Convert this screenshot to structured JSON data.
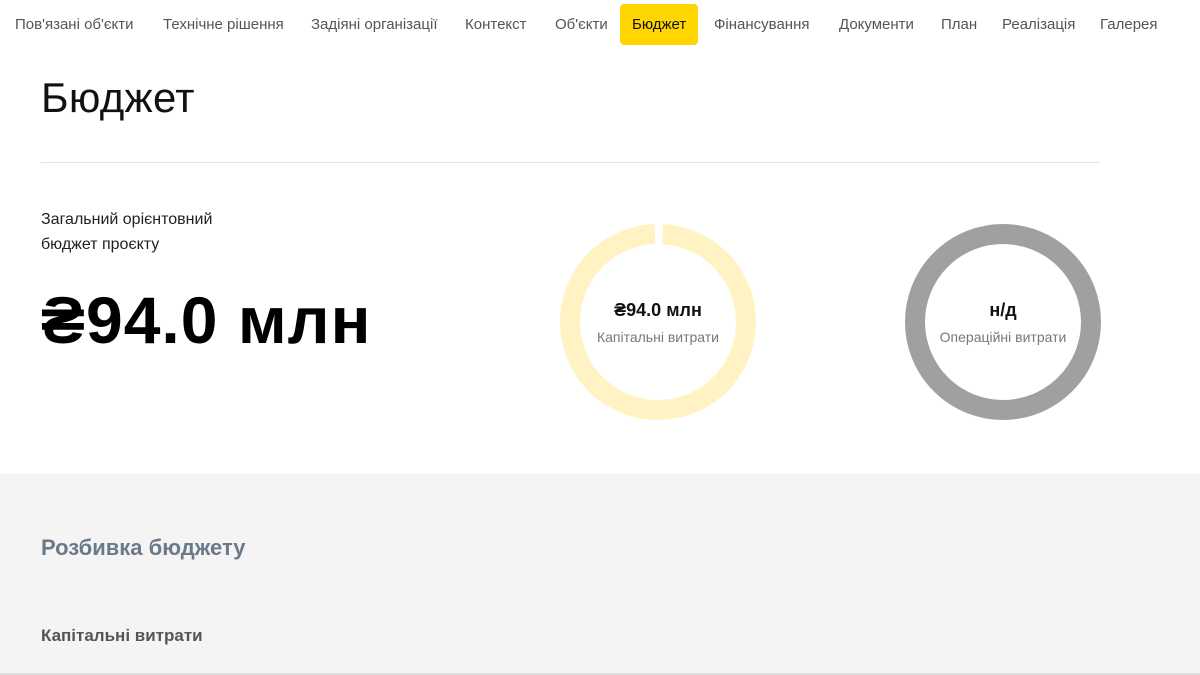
{
  "nav": {
    "items": [
      {
        "label": "Пов'язані об'єкти"
      },
      {
        "label": "Технічне рішення"
      },
      {
        "label": "Задіяні організації"
      },
      {
        "label": "Контекст"
      },
      {
        "label": "Об'єкти"
      },
      {
        "label": "Бюджет",
        "active": true
      },
      {
        "label": "Фінансування"
      },
      {
        "label": "Документи"
      },
      {
        "label": "План"
      },
      {
        "label": "Реалізація"
      },
      {
        "label": "Галерея"
      }
    ]
  },
  "page": {
    "title": "Бюджет"
  },
  "budget": {
    "total_label_line1": "Загальний орієнтовний",
    "total_label_line2": "бюджет проєкту",
    "total_value": "₴94.0 млн",
    "capex": {
      "value": "₴94.0 млн",
      "label": "Капітальні витрати",
      "color": "#fff3c4"
    },
    "opex": {
      "value": "н/д",
      "label": "Операційні витрати",
      "color": "#a0a0a0"
    }
  },
  "breakdown": {
    "title": "Розбивка бюджету",
    "capex_title": "Капітальні витрати"
  }
}
